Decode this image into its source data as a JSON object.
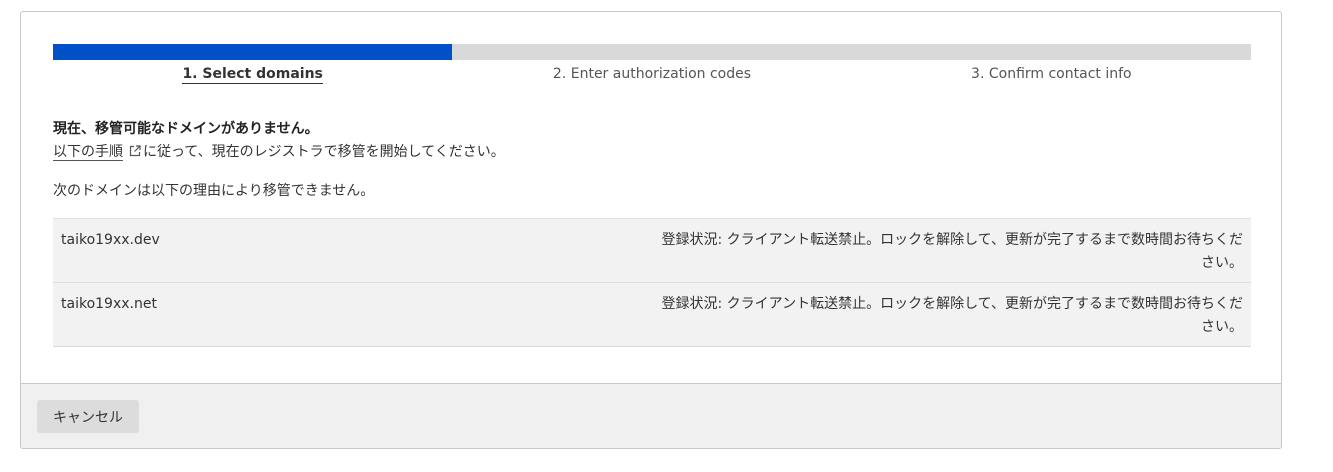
{
  "stepper": {
    "progress": 0.333,
    "steps": [
      {
        "label": "1. Select domains",
        "active": true
      },
      {
        "label": "2. Enter authorization codes",
        "active": false
      },
      {
        "label": "3. Confirm contact info",
        "active": false
      }
    ]
  },
  "notice": {
    "title": "現在、移管可能なドメインがありません。",
    "link_text": "以下の手順",
    "body_after_link": "に従って、現在のレジストラで移管を開始してください。",
    "link_icon": "external-link-icon"
  },
  "ineligible": {
    "heading": "次のドメインは以下の理由により移管できません。",
    "domains": [
      {
        "name": "taiko19xx.dev",
        "status": "登録状況: クライアント転送禁止。ロックを解除して、更新が完了するまで数時間お待ちください。"
      },
      {
        "name": "taiko19xx.net",
        "status": "登録状況: クライアント転送禁止。ロックを解除して、更新が完了するまで数時間お待ちください。"
      }
    ]
  },
  "footer": {
    "cancel_label": "キャンセル"
  },
  "colors": {
    "accent": "#0050c7",
    "track": "#d9d9d9",
    "row_background": "#f2f2f2",
    "footer_background": "#f0f0f0"
  }
}
